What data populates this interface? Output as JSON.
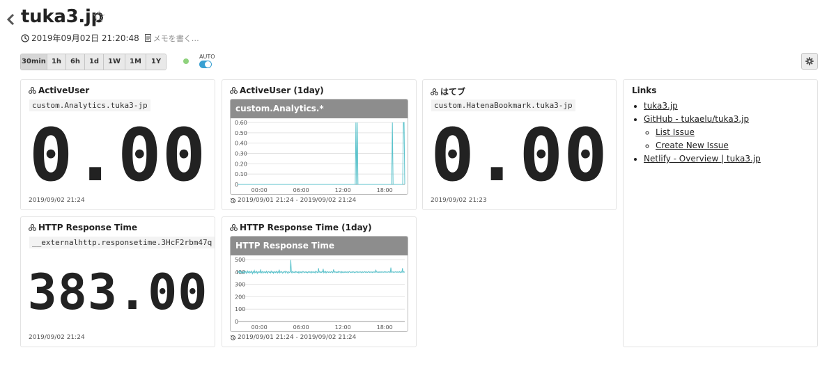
{
  "header": {
    "title": "tuka3.jp",
    "datetime": "2019年09月02日 21:20:48",
    "memo_placeholder": "メモを書く…"
  },
  "toolbar": {
    "ranges": [
      "30min",
      "1h",
      "6h",
      "1d",
      "1W",
      "1M",
      "1Y"
    ],
    "selected_range": "30min",
    "auto_label": "AUTO",
    "auto_enabled": true
  },
  "panels": {
    "active_user": {
      "title": "ActiveUser",
      "metric": "custom.Analytics.tuka3-jp",
      "value": "0.00",
      "timestamp": "2019/09/02 21:24"
    },
    "active_user_1day": {
      "title": "ActiveUser (1day)",
      "graph_title": "custom.Analytics.*",
      "range": "2019/09/01 21:24 - 2019/09/02 21:24"
    },
    "hatebu": {
      "title": "はてブ",
      "metric": "custom.HatenaBookmark.tuka3-jp",
      "value": "0.00",
      "timestamp": "2019/09/02 21:23"
    },
    "http_response": {
      "title": "HTTP Response Time",
      "metric": "__externalhttp.responsetime.3HcF2rbm47q",
      "value": "383.00",
      "timestamp": "2019/09/02 21:24"
    },
    "http_response_1day": {
      "title": "HTTP Response Time (1day)",
      "graph_title": "HTTP Response Time",
      "range": "2019/09/01 21:24 - 2019/09/02 21:24"
    },
    "links": {
      "title": "Links",
      "items": [
        {
          "label": "tuka3.jp"
        },
        {
          "label": "GitHub - tukaelu/tuka3.jp",
          "children": [
            {
              "label": "List Issue"
            },
            {
              "label": "Create New Issue"
            }
          ]
        },
        {
          "label": "Netlify - Overview | tuka3.jp"
        }
      ]
    }
  },
  "chart_data": [
    {
      "type": "line",
      "title": "custom.Analytics.*",
      "x_ticks": [
        "00:00",
        "06:00",
        "12:00",
        "18:00"
      ],
      "y_ticks": [
        "0",
        "0.10",
        "0.20",
        "0.30",
        "0.40",
        "0.50",
        "0.60"
      ],
      "ylim": [
        0,
        0.6
      ],
      "grid": true,
      "color": "#5cc3cc",
      "series": [
        {
          "values": [
            0,
            0,
            0,
            0,
            0,
            0,
            0,
            0,
            0,
            0,
            0,
            0,
            0,
            0,
            0,
            0,
            0,
            0,
            0,
            0,
            0,
            0,
            0,
            0,
            0,
            0,
            0,
            0,
            0,
            0,
            0,
            0,
            0,
            0,
            0,
            0,
            0,
            0,
            0,
            0,
            0,
            0,
            0,
            0,
            0,
            0,
            0,
            0,
            0,
            0,
            0,
            0,
            0,
            0,
            0,
            0,
            0,
            0,
            0,
            0,
            0,
            0,
            0,
            0,
            0,
            0,
            0,
            0,
            0,
            0,
            0,
            0,
            0,
            0,
            0,
            0,
            0,
            0,
            0,
            0,
            0,
            0,
            0,
            0,
            0,
            0,
            0,
            0,
            0,
            0,
            0,
            0,
            0,
            0,
            0,
            0,
            0,
            0,
            0,
            0,
            0,
            0,
            0,
            0,
            0,
            0,
            0,
            0,
            0,
            0,
            0,
            0,
            0,
            0,
            0,
            0,
            0,
            0,
            0,
            0,
            0,
            0,
            0,
            0,
            0,
            0,
            0,
            0,
            0,
            0,
            0,
            0,
            0,
            0,
            0,
            0,
            0,
            0,
            0,
            0,
            0,
            0,
            0,
            0,
            0,
            0,
            0,
            0,
            0,
            0,
            0,
            0,
            0,
            0,
            0,
            0,
            0,
            0,
            0,
            0,
            0,
            0,
            0,
            0,
            0,
            0,
            0,
            0,
            0,
            0,
            0,
            0,
            0.6,
            0,
            0.6,
            0,
            0,
            0,
            0,
            0,
            0,
            0,
            0,
            0,
            0,
            0,
            0,
            0,
            0,
            0,
            0,
            0,
            0,
            0,
            0,
            0,
            0,
            0,
            0,
            0,
            0,
            0,
            0,
            0,
            0,
            0,
            0,
            0,
            0,
            0,
            0,
            0,
            0,
            0,
            0,
            0,
            0,
            0,
            0,
            0,
            0,
            0,
            0,
            0,
            0,
            0.6,
            0,
            0,
            0,
            0,
            0,
            0,
            0,
            0,
            0,
            0,
            0,
            0,
            0,
            0,
            0,
            0.6,
            0.6,
            0
          ]
        }
      ]
    },
    {
      "type": "line",
      "title": "HTTP Response Time",
      "x_ticks": [
        "00:00",
        "06:00",
        "12:00",
        "18:00"
      ],
      "y_ticks": [
        "0",
        "100",
        "200",
        "300",
        "400",
        "500"
      ],
      "ylim": [
        0,
        500
      ],
      "grid": true,
      "color": "#5cc3cc",
      "series": [
        {
          "values": [
            400,
            398,
            405,
            392,
            401,
            410,
            396,
            388,
            402,
            399,
            394,
            406,
            391,
            400,
            403,
            389,
            397,
            408,
            395,
            401,
            390,
            404,
            399,
            393,
            407,
            398,
            386,
            402,
            396,
            411,
            392,
            400,
            397,
            405,
            388,
            399,
            403,
            394,
            401,
            396,
            420,
            392,
            399,
            404,
            390,
            398,
            402,
            395,
            400,
            393,
            406,
            397,
            389,
            401,
            404,
            396,
            399,
            392,
            407,
            398,
            395,
            401,
            390,
            403,
            397,
            400,
            394,
            405,
            399,
            391,
            402,
            396,
            418,
            393,
            400,
            398,
            404,
            395,
            390,
            401,
            397,
            399,
            406,
            392,
            400,
            403,
            396,
            388,
            402,
            399,
            395,
            401,
            497,
            398,
            392,
            404,
            400,
            396,
            399,
            393,
            405,
            398,
            401,
            394,
            397,
            402,
            390,
            399,
            403,
            396,
            400,
            392,
            398,
            405,
            401,
            394,
            399,
            397,
            402,
            395,
            400,
            393,
            398,
            404,
            396,
            401,
            399,
            391,
            403,
            397,
            400,
            395,
            402,
            398,
            392,
            406,
            399,
            401,
            394,
            397,
            430,
            398,
            402,
            395,
            400,
            396,
            403,
            399,
            425,
            394,
            401,
            397,
            405,
            392,
            400,
            398,
            403,
            396,
            399,
            401,
            395,
            397,
            404,
            400,
            393,
            399,
            420,
            396,
            402,
            398,
            401,
            394,
            399,
            397,
            405,
            395,
            400,
            402,
            398,
            392,
            403,
            396,
            401,
            399,
            394,
            400,
            397,
            402,
            396,
            399,
            401,
            393,
            398,
            404,
            400,
            395,
            399,
            397,
            401,
            396,
            402,
            398,
            394,
            400,
            397,
            399,
            403,
            395,
            401,
            398,
            396,
            400,
            402,
            397,
            399,
            394,
            401,
            398,
            396,
            400,
            403,
            397,
            399,
            401,
            395,
            398,
            400,
            404,
            396,
            399,
            397,
            401,
            398,
            395,
            402,
            399,
            397,
            400,
            396,
            418,
            399,
            401,
            398,
            395,
            400,
            397,
            402,
            399,
            396,
            401,
            398,
            400,
            397,
            399,
            403,
            396,
            401,
            398,
            400,
            397,
            399,
            402,
            396,
            401,
            398,
            435,
            397,
            400,
            399,
            401,
            395,
            398,
            400,
            402,
            396,
            399,
            401,
            397,
            400,
            398,
            403,
            395,
            399,
            401,
            397,
            430,
            396,
            402,
            399,
            398
          ]
        }
      ]
    }
  ]
}
